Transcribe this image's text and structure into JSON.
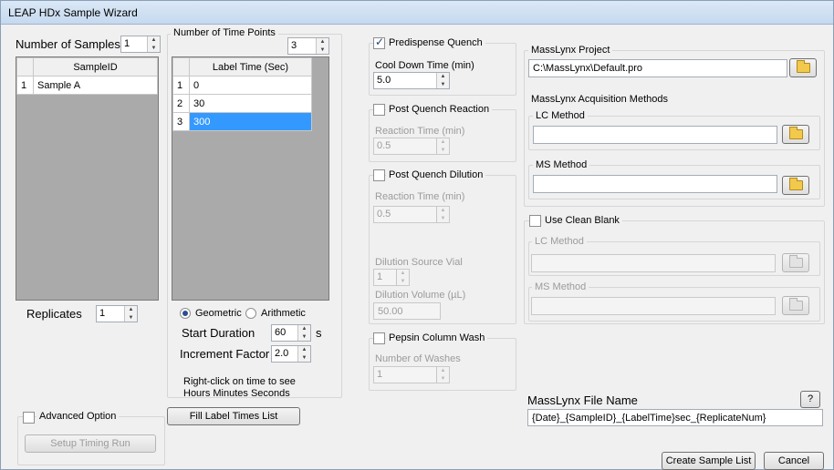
{
  "window": {
    "title": "LEAP HDx Sample Wizard"
  },
  "samples": {
    "label": "Number of Samples",
    "count": "1",
    "column_header": "SampleID",
    "rows": [
      {
        "num": "1",
        "id": "Sample A"
      }
    ],
    "replicates_label": "Replicates",
    "replicates_value": "1"
  },
  "timepoints": {
    "label": "Number of Time Points",
    "count": "3",
    "column_header": "Label Time (Sec)",
    "rows": [
      {
        "num": "1",
        "time": "0"
      },
      {
        "num": "2",
        "time": "30"
      },
      {
        "num": "3",
        "time": "300"
      }
    ],
    "geometric_label": "Geometric",
    "arithmetic_label": "Arithmetic",
    "start_duration_label": "Start Duration",
    "start_duration_value": "60",
    "start_duration_unit": "s",
    "increment_factor_label": "Increment Factor",
    "increment_factor_value": "2.0",
    "hint_line1": "Right-click on time to see",
    "hint_line2": "Hours Minutes Seconds",
    "fill_button": "Fill Label Times List"
  },
  "advanced": {
    "label": "Advanced Option",
    "setup_button": "Setup Timing Run"
  },
  "predispense": {
    "label": "Predispense Quench",
    "cooldown_label": "Cool Down Time (min)",
    "cooldown_value": "5.0"
  },
  "post_quench_reaction": {
    "label": "Post Quench Reaction",
    "reaction_time_label": "Reaction Time (min)",
    "reaction_time_value": "0.5"
  },
  "post_quench_dilution": {
    "label": "Post Quench Dilution",
    "reaction_time_label": "Reaction Time (min)",
    "reaction_time_value": "0.5",
    "source_vial_label": "Dilution Source Vial",
    "source_vial_value": "1",
    "volume_label": "Dilution Volume (µL)",
    "volume_value": "50.00"
  },
  "pepsin": {
    "label": "Pepsin Column Wash",
    "washes_label": "Number of Washes",
    "washes_value": "1"
  },
  "masslynx": {
    "project_label": "MassLynx Project",
    "project_value": "C:\\MassLynx\\Default.pro",
    "acq_label": "MassLynx Acquisition Methods",
    "lc_label": "LC Method",
    "lc_value": "",
    "ms_label": "MS Method",
    "ms_value": ""
  },
  "clean_blank": {
    "label": "Use Clean Blank",
    "lc_label": "LC Method",
    "ms_label": "MS Method"
  },
  "filename": {
    "label": "MassLynx File Name",
    "help": "?",
    "value": "{Date}_{SampleID}_{LabelTime}sec_{ReplicateNum}"
  },
  "footer": {
    "create_button": "Create Sample List",
    "cancel_button": "Cancel"
  },
  "colors": {
    "selection": "#3399ff",
    "folder": "#f2c94c",
    "titlebar": "#c6d9ef"
  }
}
